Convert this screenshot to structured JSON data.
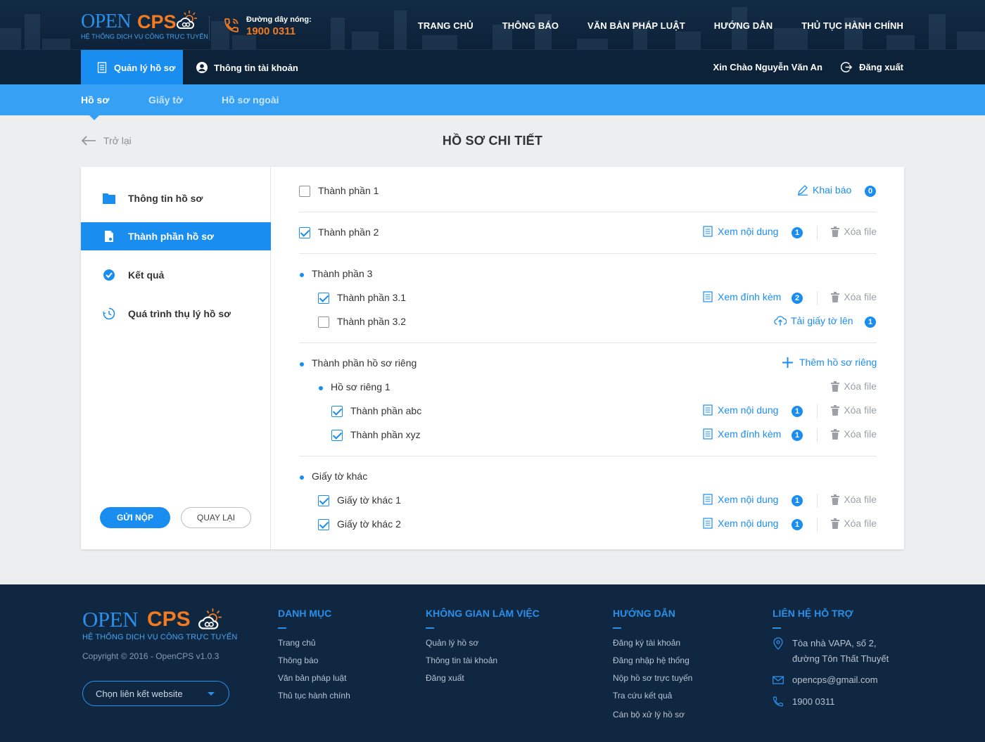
{
  "brand": {
    "logo_open": "OPEN",
    "logo_cps": "CPS",
    "tagline": "HỆ THỐNG DỊCH VỤ CÔNG TRỰC TUYẾN",
    "accent": "#1a8ef0",
    "orange": "#f47a20",
    "navy": "#0f2740"
  },
  "header": {
    "hotline_label": "Đường dây nóng:",
    "hotline_number": "1900 0311",
    "nav": [
      "TRANG CHỦ",
      "THÔNG BÁO",
      "VĂN BẢN PHÁP LUẬT",
      "HƯỚNG DẪN",
      "THỦ TỤC HÀNH CHÍNH"
    ]
  },
  "subnav": {
    "manage_label": "Quản lý hồ sơ",
    "account_label": "Thông tin tài khoản",
    "greeting": "Xin Chào Nguyễn Văn An",
    "logout_label": "Đăng xuất"
  },
  "tabs": {
    "items": [
      "Hồ sơ",
      "Giấy tờ",
      "Hồ sơ ngoài"
    ],
    "active": "Hồ sơ"
  },
  "page": {
    "back_label": "Trở lại",
    "title": "HỒ SƠ CHI TIẾT"
  },
  "sidebar": {
    "items": [
      "Thông tin hồ sơ",
      "Thành phần hồ sơ",
      "Kết quả",
      "Quá trình thụ lý hồ sơ"
    ],
    "active": "Thành phần hồ sơ",
    "submit_label": "GỬI NỘP",
    "back_label": "QUAY LẠI"
  },
  "components": {
    "delete_label": "Xóa file",
    "row1": {
      "label": "Thành phần 1",
      "checked": false,
      "action": "Khai báo",
      "count": "0"
    },
    "row2": {
      "label": "Thành phần 2",
      "checked": true,
      "action": "Xem nội dung",
      "count": "1"
    },
    "group3": {
      "label": "Thành phần 3",
      "r1": {
        "label": "Thành phần 3.1",
        "checked": true,
        "action": "Xem đính kèm",
        "count": "2"
      },
      "r2": {
        "label": "Thành phần 3.2",
        "checked": false,
        "action": "Tải giấy tờ lên",
        "count": "1"
      }
    },
    "private_group": {
      "label": "Thành phần hồ sơ riêng",
      "add_label": "Thêm hồ sơ riêng",
      "sub_label": "Hồ sơ riêng 1",
      "r1": {
        "label": "Thành phần abc",
        "checked": true,
        "action": "Xem nội dung",
        "count": "1"
      },
      "r2": {
        "label": "Thành phần xyz",
        "checked": true,
        "action": "Xem đính kèm",
        "count": "1"
      }
    },
    "other_group": {
      "label": "Giấy tờ khác",
      "r1": {
        "label": "Giấy tờ khác 1",
        "checked": true,
        "action": "Xem nội dung",
        "count": "1"
      },
      "r2": {
        "label": "Giấy tờ khác 2",
        "checked": true,
        "action": "Xem nội dung",
        "count": "1"
      }
    }
  },
  "footer": {
    "copyright": "Copyright © 2016 - OpenCPS v1.0.3",
    "select_label": "Chọn liên kết website",
    "col1": {
      "title": "DANH MỤC",
      "links": [
        "Trang chủ",
        "Thông báo",
        "Văn bản pháp luật",
        "Thủ tục hành chính"
      ]
    },
    "col2": {
      "title": "KHÔNG GIAN LÀM VIỆC",
      "links": [
        "Quản lý hồ sơ",
        "Thông tin tài khoản",
        "Đăng xuất"
      ]
    },
    "col3": {
      "title": "HƯỚNG DẪN",
      "links": [
        "Đăng ký tài khoản",
        "Đăng nhập hệ thống",
        "Nộp hồ sơ trực tuyến",
        "Tra cứu kết quả",
        "Cán bộ xử lý hồ sơ"
      ]
    },
    "col4": {
      "title": "LIÊN HỆ HỖ TRỢ",
      "address_1": "Tòa nhà VAPA, số 2,",
      "address_2": "đường Tôn Thất Thuyết",
      "email": "opencps@gmail.com",
      "phone": "1900 0311"
    }
  }
}
